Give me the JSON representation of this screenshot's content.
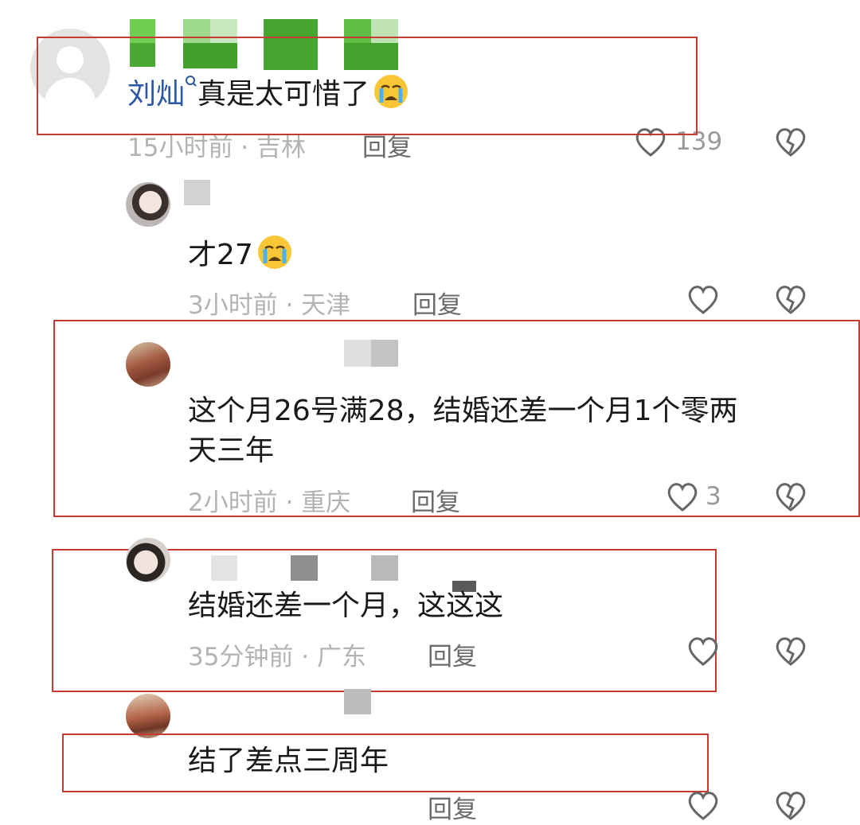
{
  "comments": [
    {
      "username": "刘灿",
      "search_icon": "search-icon",
      "text": "真是太可惜了",
      "emoji": "crying-face-emoji",
      "time_location": "15小时前 · 吉林",
      "reply_label": "回复",
      "like_count": "139"
    },
    {
      "text": "才27",
      "emoji": "crying-face-emoji",
      "time_location": "3小时前 · 天津",
      "reply_label": "回复",
      "like_count": ""
    },
    {
      "text_line1": "这个月26号满28，结婚还差一个月1个零两",
      "text_line2": "天三年",
      "time_location": "2小时前 · 重庆",
      "reply_label": "回复",
      "like_count": "3"
    },
    {
      "text": "结婚还差一个月，这这这",
      "time_location": "35分钟前 · 广东",
      "reply_label": "回复",
      "like_count": ""
    },
    {
      "text": "结了差点三周年",
      "time_location": "",
      "reply_label": "回复",
      "like_count": ""
    }
  ],
  "colors": {
    "highlight_box": "#c83a34",
    "username": "#2a58a5",
    "mosaic_green": "#4aa832",
    "mosaic_gray": "#c9c9c9"
  }
}
